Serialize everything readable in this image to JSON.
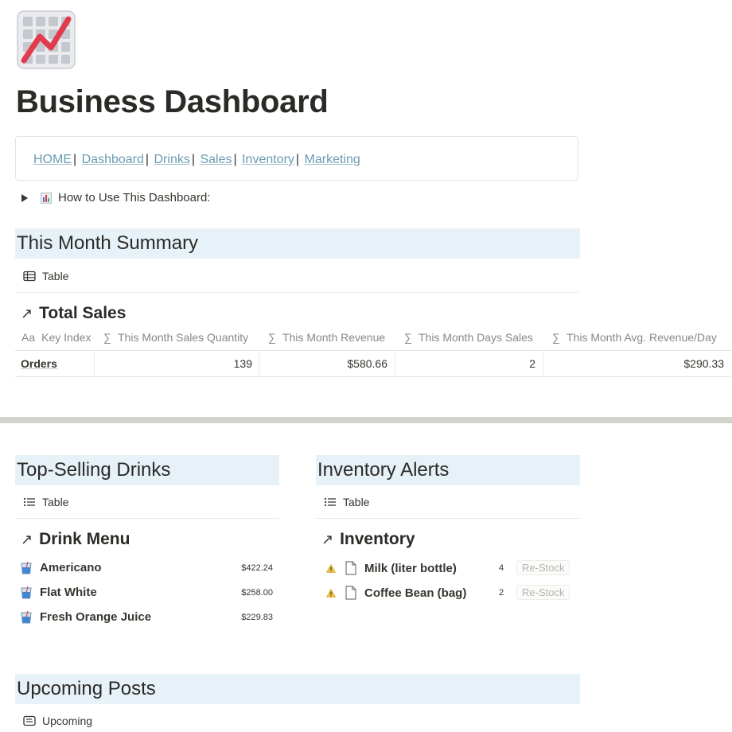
{
  "page": {
    "title": "Business Dashboard",
    "icon": "chart-increasing-icon"
  },
  "nav": {
    "links": [
      "HOME",
      "Dashboard",
      "Drinks",
      "Sales",
      "Inventory",
      "Marketing"
    ],
    "separator": "|"
  },
  "toggle": {
    "label": "How to Use This Dashboard:",
    "icon": "bar-chart-icon"
  },
  "summary": {
    "heading": "This Month Summary",
    "view_tab": "Table",
    "db_title": "Total Sales",
    "columns": [
      {
        "icon": "Aa",
        "label": "Key Index"
      },
      {
        "icon": "∑",
        "label": "This Month Sales Quantity"
      },
      {
        "icon": "∑",
        "label": "This Month Revenue"
      },
      {
        "icon": "∑",
        "label": "This Month Days Sales"
      },
      {
        "icon": "∑",
        "label": "This Month Avg. Revenue/Day"
      }
    ],
    "row": [
      "Orders",
      "139",
      "$580.66",
      "2",
      "$290.33"
    ]
  },
  "drinks": {
    "heading": "Top-Selling Drinks",
    "view_tab": "Table",
    "db_title": "Drink Menu",
    "items": [
      {
        "name": "Americano",
        "price": "$422.24"
      },
      {
        "name": "Flat White",
        "price": "$258.00"
      },
      {
        "name": "Fresh Orange Juice",
        "price": "$229.83"
      }
    ]
  },
  "inventory": {
    "heading": "Inventory Alerts",
    "view_tab": "Table",
    "db_title": "Inventory",
    "items": [
      {
        "name": "Milk (liter bottle)",
        "qty": "4",
        "tag": "Re-Stock"
      },
      {
        "name": "Coffee Bean (bag)",
        "qty": "2",
        "tag": "Re-Stock"
      }
    ]
  },
  "posts": {
    "heading": "Upcoming Posts",
    "view_tab": "Upcoming"
  },
  "colors": {
    "heading_band": "#e7f1f8",
    "link": "#6b9bb3",
    "divider": "#d3d3cd",
    "chart_line": "#e03b4e"
  }
}
